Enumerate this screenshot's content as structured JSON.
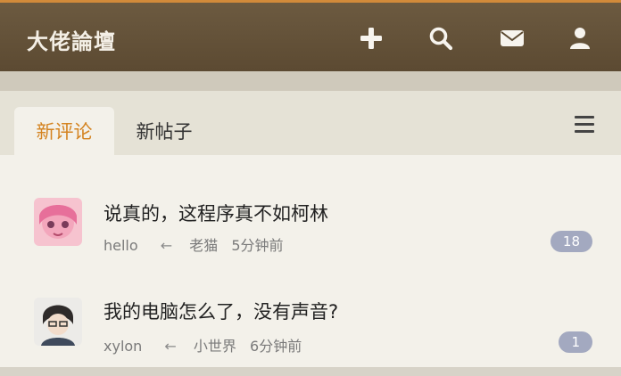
{
  "header": {
    "logo": "大佬論壇",
    "icons": [
      "plus-icon",
      "search-icon",
      "envelope-icon",
      "user-icon"
    ],
    "bg_color": "#5c4a32",
    "accent_color": "#d18a3a"
  },
  "tabs": [
    {
      "label": "新评论",
      "active": true
    },
    {
      "label": "新帖子",
      "active": false
    }
  ],
  "posts": [
    {
      "title": "说真的，这程序真不如柯林",
      "author": "hello",
      "arrow": "←",
      "replier": "老猫",
      "time": "5分钟前",
      "count": "18"
    },
    {
      "title": "我的电脑怎么了，没有声音?",
      "author": "xylon",
      "arrow": "←",
      "replier": "小世界",
      "time": "6分钟前",
      "count": "1"
    }
  ],
  "colors": {
    "active_tab": "#d48320",
    "badge": "#a3a9c0"
  }
}
